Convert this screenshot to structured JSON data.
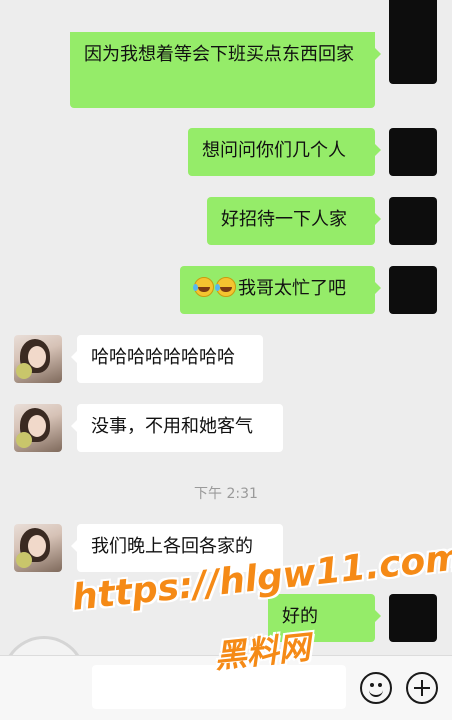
{
  "messages": [
    {
      "side": "self",
      "text": "因为我想着等会下班买点东西回家"
    },
    {
      "side": "self",
      "text": "想问问你们几个人"
    },
    {
      "side": "self",
      "text": "好招待一下人家"
    },
    {
      "side": "self",
      "emoji": [
        "laughing-crying-emoji",
        "laughing-crying-emoji"
      ],
      "text": "我哥太忙了吧"
    },
    {
      "side": "other",
      "text": "哈哈哈哈哈哈哈哈"
    },
    {
      "side": "other",
      "text": "没事，不用和她客气"
    },
    {
      "side": "other",
      "text": "我们晚上各回各家的"
    },
    {
      "side": "self",
      "text": "好的"
    }
  ],
  "timestamp": "下午 2:31",
  "watermark": {
    "url": "https://hlgw11.com",
    "site_name": "黑料网"
  },
  "input_bar": {
    "value": "",
    "icons": [
      "emoji-icon",
      "plus-icon"
    ]
  },
  "colors": {
    "self_bubble": "#95ec69",
    "other_bubble": "#ffffff",
    "background": "#ededed",
    "watermark": "#f58a16"
  }
}
